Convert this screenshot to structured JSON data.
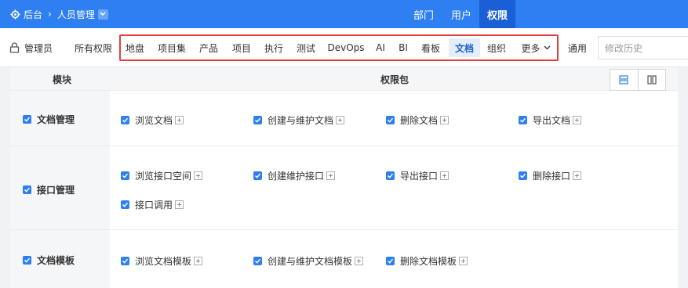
{
  "header": {
    "breadcrumb": [
      "后台",
      "人员管理"
    ],
    "nav": [
      "部门",
      "用户",
      "权限"
    ],
    "active_nav": "权限"
  },
  "toolbar": {
    "role": "管理员",
    "all_permissions": "所有权限",
    "tabs": [
      "地盘",
      "项目集",
      "产品",
      "项目",
      "执行",
      "测试",
      "DevOps",
      "AI",
      "BI",
      "看板",
      "文档",
      "组织",
      "更多"
    ],
    "active_tab": "文档",
    "general": "通用",
    "history_placeholder": "修改历史"
  },
  "table": {
    "col_module": "模块",
    "col_permissions": "权限包",
    "rows": [
      {
        "module": "文档管理",
        "permissions": [
          "浏览文档",
          "创建与维护文档",
          "删除文档",
          "导出文档"
        ]
      },
      {
        "module": "接口管理",
        "permissions": [
          "浏览接口空间",
          "创建维护接口",
          "导出接口",
          "删除接口",
          "接口调用"
        ]
      },
      {
        "module": "文档模板",
        "permissions": [
          "浏览文档模板",
          "创建与维护文档模板",
          "删除文档模板"
        ]
      }
    ]
  },
  "colors": {
    "brand": "#2e7ff1",
    "highlight_box": "#e23f3f"
  }
}
